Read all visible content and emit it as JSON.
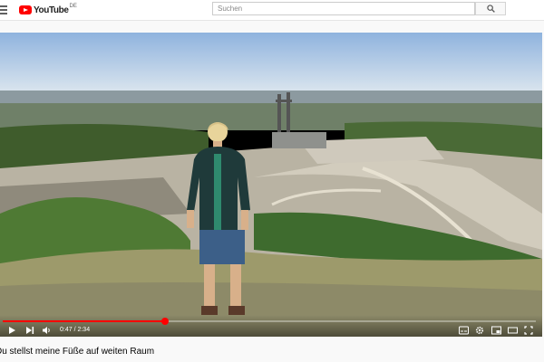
{
  "header": {
    "logo_text": "YouTube",
    "logo_region": "DE",
    "search_placeholder": "Suchen",
    "icons": [
      "menu-icon",
      "search-icon"
    ]
  },
  "player": {
    "current_time": "0:47",
    "duration": "2:34",
    "progress_fraction": 0.305,
    "controls": [
      "play-icon",
      "next-icon",
      "volume-icon",
      "subtitles-icon",
      "settings-icon",
      "miniplayer-icon",
      "theater-icon",
      "fullscreen-icon"
    ]
  },
  "video": {
    "title": "Du stellst meine Füße auf weiten Raum"
  },
  "colors": {
    "brand": "#ff0000",
    "page_bg": "#f9f9f9"
  }
}
